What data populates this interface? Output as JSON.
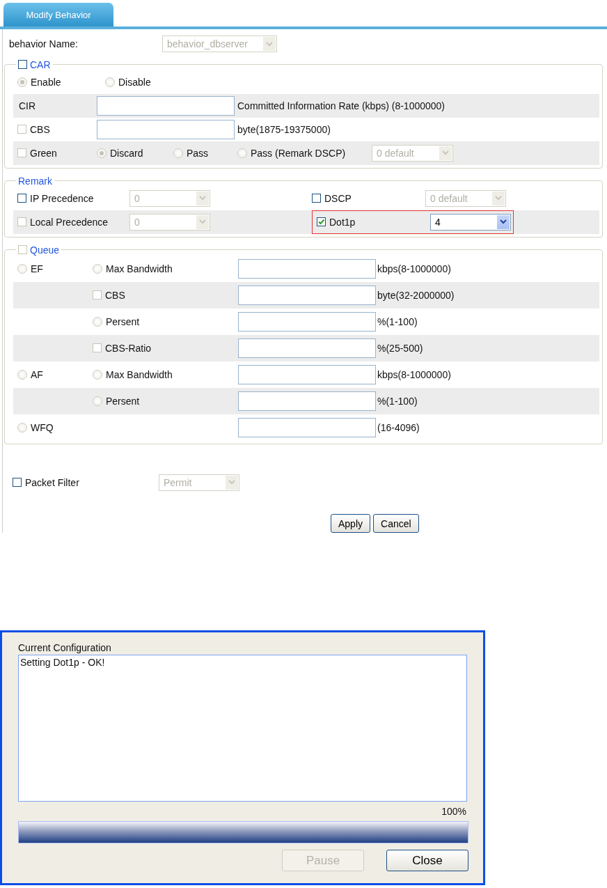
{
  "tab": {
    "label": "Modify Behavior",
    "selected": true
  },
  "behavior_name": {
    "label": "behavior Name:",
    "value": "behavior_dbserver",
    "disabled": true
  },
  "car": {
    "label": "CAR",
    "checked": false,
    "disabled": false,
    "modes": [
      {
        "label": "Enable",
        "selected": true
      },
      {
        "label": "Disable",
        "selected": false
      }
    ],
    "cir": {
      "label": "CIR",
      "hint": "Committed Information Rate (kbps) (8-1000000)"
    },
    "cbs": {
      "label": "CBS",
      "checked": false,
      "disabled": true,
      "hint": "byte(1875-19375000)"
    },
    "green": {
      "label": "Green",
      "checked": false,
      "disabled": true,
      "actions": [
        {
          "label": "Discard",
          "selected": true
        },
        {
          "label": "Pass",
          "selected": false
        },
        {
          "label": "Pass (Remark DSCP)",
          "selected": false
        }
      ],
      "dscp": {
        "value": "0 default",
        "disabled": true
      }
    }
  },
  "remark": {
    "label": "Remark",
    "rows": [
      {
        "cells": [
          {
            "label": "IP Precedence",
            "checked": false,
            "disabled": false,
            "value": "0",
            "select_disabled": true,
            "highlighted": false
          },
          {
            "label": "DSCP",
            "checked": false,
            "disabled": false,
            "value": "0 default",
            "select_disabled": true,
            "highlighted": false
          }
        ]
      },
      {
        "cells": [
          {
            "label": "Local Precedence",
            "checked": false,
            "disabled": true,
            "value": "0",
            "select_disabled": true,
            "highlighted": false
          },
          {
            "label": "Dot1p",
            "checked": true,
            "disabled": false,
            "value": "4",
            "select_disabled": false,
            "highlighted": true
          }
        ]
      }
    ]
  },
  "queue": {
    "label": "Queue",
    "checked": false,
    "disabled": true,
    "rows": [
      {
        "class": {
          "label": "EF",
          "selected": false
        },
        "option": {
          "kind": "radio",
          "label": "Max Bandwidth",
          "selected": false
        },
        "hint": "kbps(8-1000000)"
      },
      {
        "option": {
          "kind": "checkbox",
          "label": "CBS",
          "checked": false,
          "disabled": true
        },
        "hint": "byte(32-2000000)"
      },
      {
        "option": {
          "kind": "radio",
          "label": "Persent",
          "selected": false
        },
        "hint": "%(1-100)"
      },
      {
        "option": {
          "kind": "checkbox",
          "label": "CBS-Ratio",
          "checked": false,
          "disabled": true
        },
        "hint": "%(25-500)"
      },
      {
        "class": {
          "label": "AF",
          "selected": false
        },
        "option": {
          "kind": "radio",
          "label": "Max Bandwidth",
          "selected": false
        },
        "hint": "kbps(8-1000000)"
      },
      {
        "option": {
          "kind": "radio",
          "label": "Persent",
          "selected": false
        },
        "hint": "%(1-100)"
      },
      {
        "class": {
          "label": "WFQ",
          "selected": false
        },
        "hint": "(16-4096)"
      }
    ]
  },
  "packet_filter": {
    "label": "Packet Filter",
    "checked": false,
    "disabled": false,
    "value": "Permit",
    "select_disabled": true
  },
  "buttons": [
    "Apply",
    "Cancel"
  ],
  "dialog": {
    "title": "Current Configuration",
    "log": "Setting Dot1p - OK!",
    "percent": "100%",
    "level": 1,
    "buttons": [
      {
        "label": "Pause",
        "disabled": true
      },
      {
        "label": "Close",
        "disabled": false
      }
    ]
  }
}
